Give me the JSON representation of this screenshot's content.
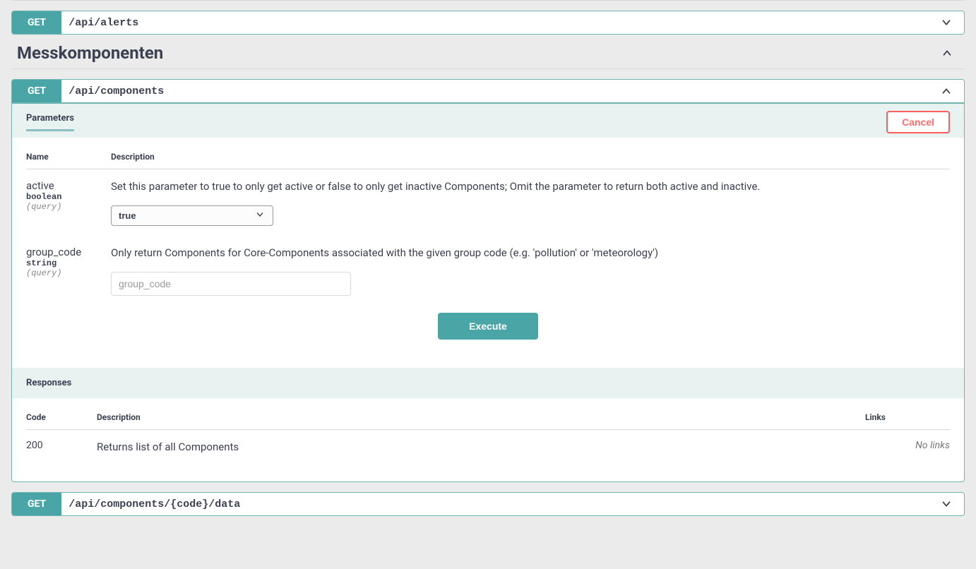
{
  "colors": {
    "method_get": "#4aa6a6",
    "cancel": "#ff6b6b"
  },
  "op_alerts": {
    "method": "GET",
    "path": "/api/alerts"
  },
  "section_title": "Messkomponenten",
  "op_components": {
    "method": "GET",
    "path": "/api/components",
    "parameters_tab": "Parameters",
    "cancel_label": "Cancel",
    "cols": {
      "name": "Name",
      "description": "Description"
    },
    "param_active": {
      "name": "active",
      "type": "boolean",
      "in": "(query)",
      "description": "Set this parameter to true to only get active or false to only get inactive Components; Omit the parameter to return both active and inactive.",
      "selected": "true"
    },
    "param_group_code": {
      "name": "group_code",
      "type": "string",
      "in": "(query)",
      "description": "Only return Components for Core-Components associated with the given group code (e.g. 'pollution' or 'meteorology')",
      "placeholder": "group_code"
    },
    "execute_label": "Execute",
    "responses_label": "Responses",
    "resp_cols": {
      "code": "Code",
      "description": "Description",
      "links": "Links"
    },
    "response_200": {
      "code": "200",
      "description": "Returns list of all Components",
      "links": "No links"
    }
  },
  "op_component_data": {
    "method": "GET",
    "path": "/api/components/{code}/data"
  }
}
